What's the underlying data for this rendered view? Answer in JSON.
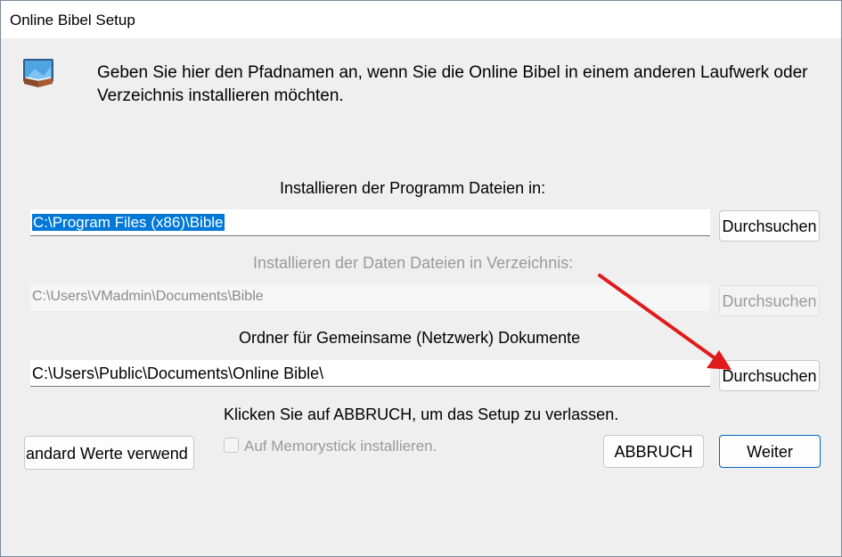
{
  "window": {
    "title": "Online Bibel Setup"
  },
  "icons": {
    "app": "bible-computer-icon",
    "arrow": "red-arrow-annotation"
  },
  "intro_text": "Geben Sie hier den Pfadnamen an, wenn Sie die Online Bibel in einem anderen Laufwerk oder Verzeichnis installieren möchten.",
  "program": {
    "label": "Installieren der Programm Dateien in:",
    "path": "C:\\Program Files (x86)\\Bible",
    "browse_label": "Durchsuchen"
  },
  "data_dir": {
    "label": "Installieren der Daten Dateien in Verzeichnis:",
    "path": "C:\\Users\\VMadmin\\Documents\\Bible",
    "browse_label": "Durchsuchen"
  },
  "shared": {
    "label": "Ordner für Gemeinsame  (Netzwerk) Dokumente",
    "path": "C:\\Users\\Public\\Documents\\Online Bible\\",
    "browse_label": "Durchsuchen"
  },
  "cancel_hint": "Klicken Sie auf ABBRUCH, um das Setup zu verlassen.",
  "buttons": {
    "defaults": "andard Werte verwend",
    "cancel": "ABBRUCH",
    "next": "Weiter"
  },
  "memorystick": {
    "label": "Auf Memorystick installieren.",
    "checked": false
  },
  "colors": {
    "accent": "#0078d7",
    "arrow": "#e01b1b",
    "disabled_text": "#9a9a9a"
  }
}
